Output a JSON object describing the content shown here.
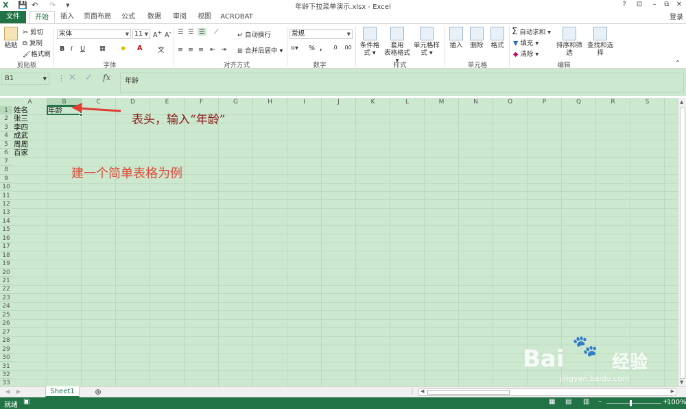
{
  "window": {
    "title": "年龄下拉菜单演示.xlsx - Excel",
    "controls": [
      "?",
      "⊡",
      "–",
      "⧉",
      "✕"
    ]
  },
  "tabs": {
    "file": "文件",
    "items": [
      "开始",
      "插入",
      "页面布局",
      "公式",
      "数据",
      "审阅",
      "视图",
      "ACROBAT"
    ],
    "active": "开始",
    "login": "登录"
  },
  "ribbon": {
    "clipboard": {
      "paste": "粘贴",
      "cut": "剪切",
      "copy": "复制",
      "format_painter": "格式刷",
      "label": "剪贴板"
    },
    "font": {
      "name": "宋体",
      "size": "11",
      "bold": "B",
      "italic": "I",
      "underline": "U",
      "label": "字体"
    },
    "alignment": {
      "wrap": "自动换行",
      "merge": "合并后居中",
      "label": "对齐方式"
    },
    "number": {
      "format": "常规",
      "percent": "%",
      "comma": ",",
      "label": "数字"
    },
    "styles": {
      "conditional": "条件格式",
      "table_fmt_1": "套用",
      "table_fmt_2": "表格格式",
      "cell_styles": "单元格样式",
      "label": "样式"
    },
    "cells": {
      "insert": "插入",
      "delete": "删除",
      "format": "格式",
      "label": "单元格"
    },
    "editing": {
      "autosum": "自动求和",
      "fill": "填充",
      "clear": "清除",
      "sort": "排序和筛选",
      "find": "查找和选择",
      "label": "编辑"
    }
  },
  "formula_bar": {
    "name_box": "B1",
    "fx": "fx",
    "content": "年龄"
  },
  "grid": {
    "columns": [
      "A",
      "B",
      "C",
      "D",
      "E",
      "F",
      "G",
      "H",
      "I",
      "J",
      "K",
      "L",
      "M",
      "N",
      "O",
      "P",
      "Q",
      "R",
      "S"
    ],
    "rows": [
      "1",
      "2",
      "3",
      "4",
      "5",
      "6",
      "7",
      "8",
      "9",
      "10",
      "11",
      "12",
      "13",
      "14",
      "15",
      "16",
      "17",
      "18",
      "19",
      "20",
      "21",
      "22",
      "23",
      "24",
      "25",
      "26",
      "27",
      "28",
      "29",
      "30",
      "31",
      "32",
      "33"
    ],
    "cells": {
      "A1": "姓名",
      "B1": "年龄",
      "A2": "张三",
      "A3": "李四",
      "A4": "成武",
      "A5": "周周",
      "A6": "百家"
    }
  },
  "annotations": {
    "header_note": "表头，输入“年龄”",
    "table_note": "建一个简单表格为例"
  },
  "sheets": {
    "tabs": [
      "Sheet1"
    ],
    "add": "⊕"
  },
  "status": {
    "mode": "就绪",
    "zoom": "100%"
  },
  "watermark": {
    "brand": "Bai",
    "brand2": "经验",
    "url": "jingyan.baidu.com"
  },
  "colors": {
    "excel_green": "#217346",
    "grid_bg": "#cce8cf",
    "annotation": "#c0392b"
  }
}
